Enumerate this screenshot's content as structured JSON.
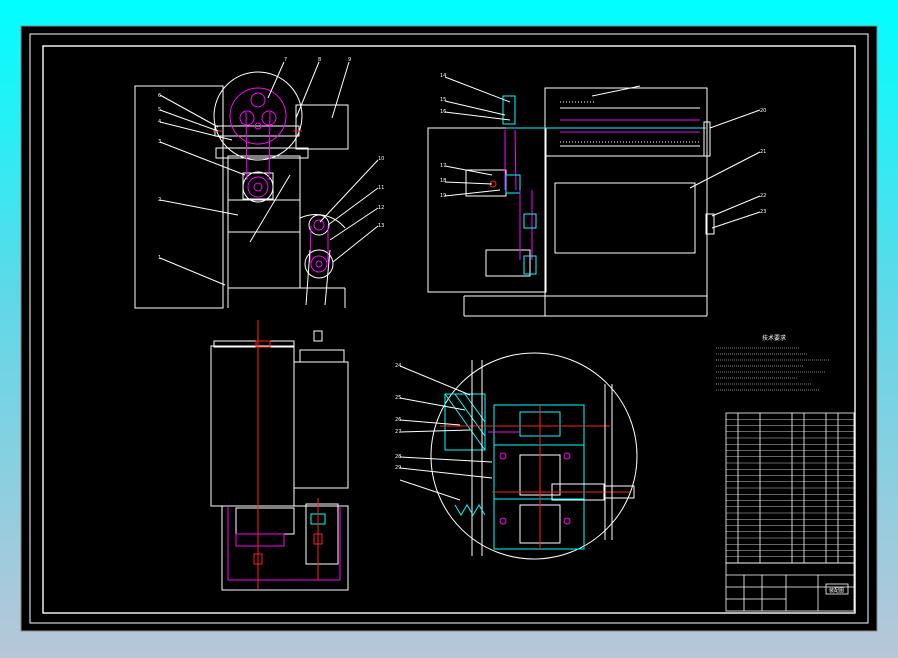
{
  "colors": {
    "frame_outer": "#00ffff",
    "sheet": "#000000",
    "line": "#ffffff",
    "accent_magenta": "#ff00ff",
    "accent_cyan": "#00ffff",
    "accent_red": "#ff2020",
    "accent_green": "#00ff00",
    "accent_yellow": "#ffff00"
  },
  "balloons": {
    "front_view": [
      "7",
      "8",
      "9",
      "6",
      "5",
      "4",
      "3",
      "2",
      "1",
      "10",
      "11",
      "12",
      "13"
    ],
    "side_view": [
      "14",
      "15",
      "16",
      "17",
      "18",
      "19",
      "20",
      "21",
      "22",
      "23"
    ],
    "detail_view": [
      "24",
      "25",
      "26",
      "27",
      "28",
      "29"
    ]
  },
  "tech_notes_title": "技术要求",
  "title_block_name": "装配图"
}
